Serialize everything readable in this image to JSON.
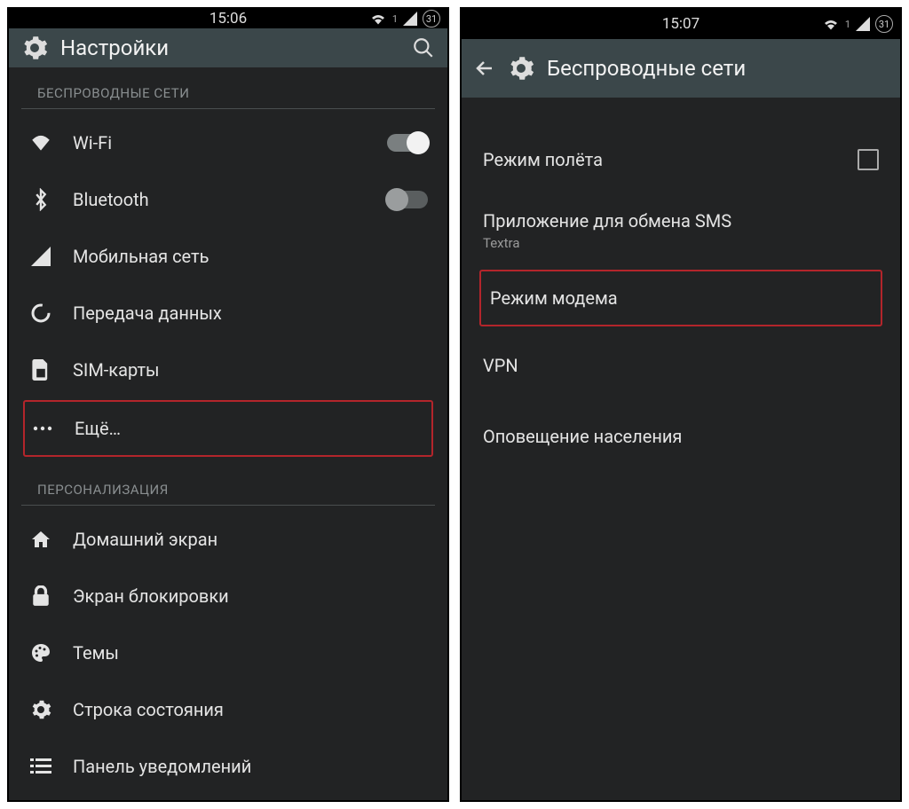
{
  "left": {
    "time": "15:06",
    "sim_badge": "1",
    "day_badge": "31",
    "title": "Настройки",
    "sections": {
      "wireless": {
        "header": "БЕСПРОВОДНЫЕ СЕТИ",
        "items": [
          {
            "id": "wifi",
            "label": "Wi-Fi",
            "toggle": "on"
          },
          {
            "id": "bluetooth",
            "label": "Bluetooth",
            "toggle": "off"
          },
          {
            "id": "mobile",
            "label": "Мобильная сеть"
          },
          {
            "id": "data",
            "label": "Передача данных"
          },
          {
            "id": "sim",
            "label": "SIM-карты"
          },
          {
            "id": "more",
            "label": "Ещё…",
            "highlight": true
          }
        ]
      },
      "personalization": {
        "header": "ПЕРСОНАЛИЗАЦИЯ",
        "items": [
          {
            "id": "home",
            "label": "Домашний экран"
          },
          {
            "id": "lock",
            "label": "Экран блокировки"
          },
          {
            "id": "themes",
            "label": "Темы"
          },
          {
            "id": "statusbar",
            "label": "Строка состояния"
          },
          {
            "id": "notifpanel",
            "label": "Панель уведомлений"
          }
        ]
      }
    }
  },
  "right": {
    "time": "15:07",
    "sim_badge": "1",
    "day_badge": "31",
    "title": "Беспроводные сети",
    "items": [
      {
        "id": "airplane",
        "label": "Режим полёта",
        "checkbox": true
      },
      {
        "id": "smsapp",
        "label": "Приложение для обмена SMS",
        "subtitle": "Textra"
      },
      {
        "id": "tether",
        "label": "Режим модема",
        "highlight": true
      },
      {
        "id": "vpn",
        "label": "VPN"
      },
      {
        "id": "alerts",
        "label": "Оповещение населения"
      }
    ]
  }
}
